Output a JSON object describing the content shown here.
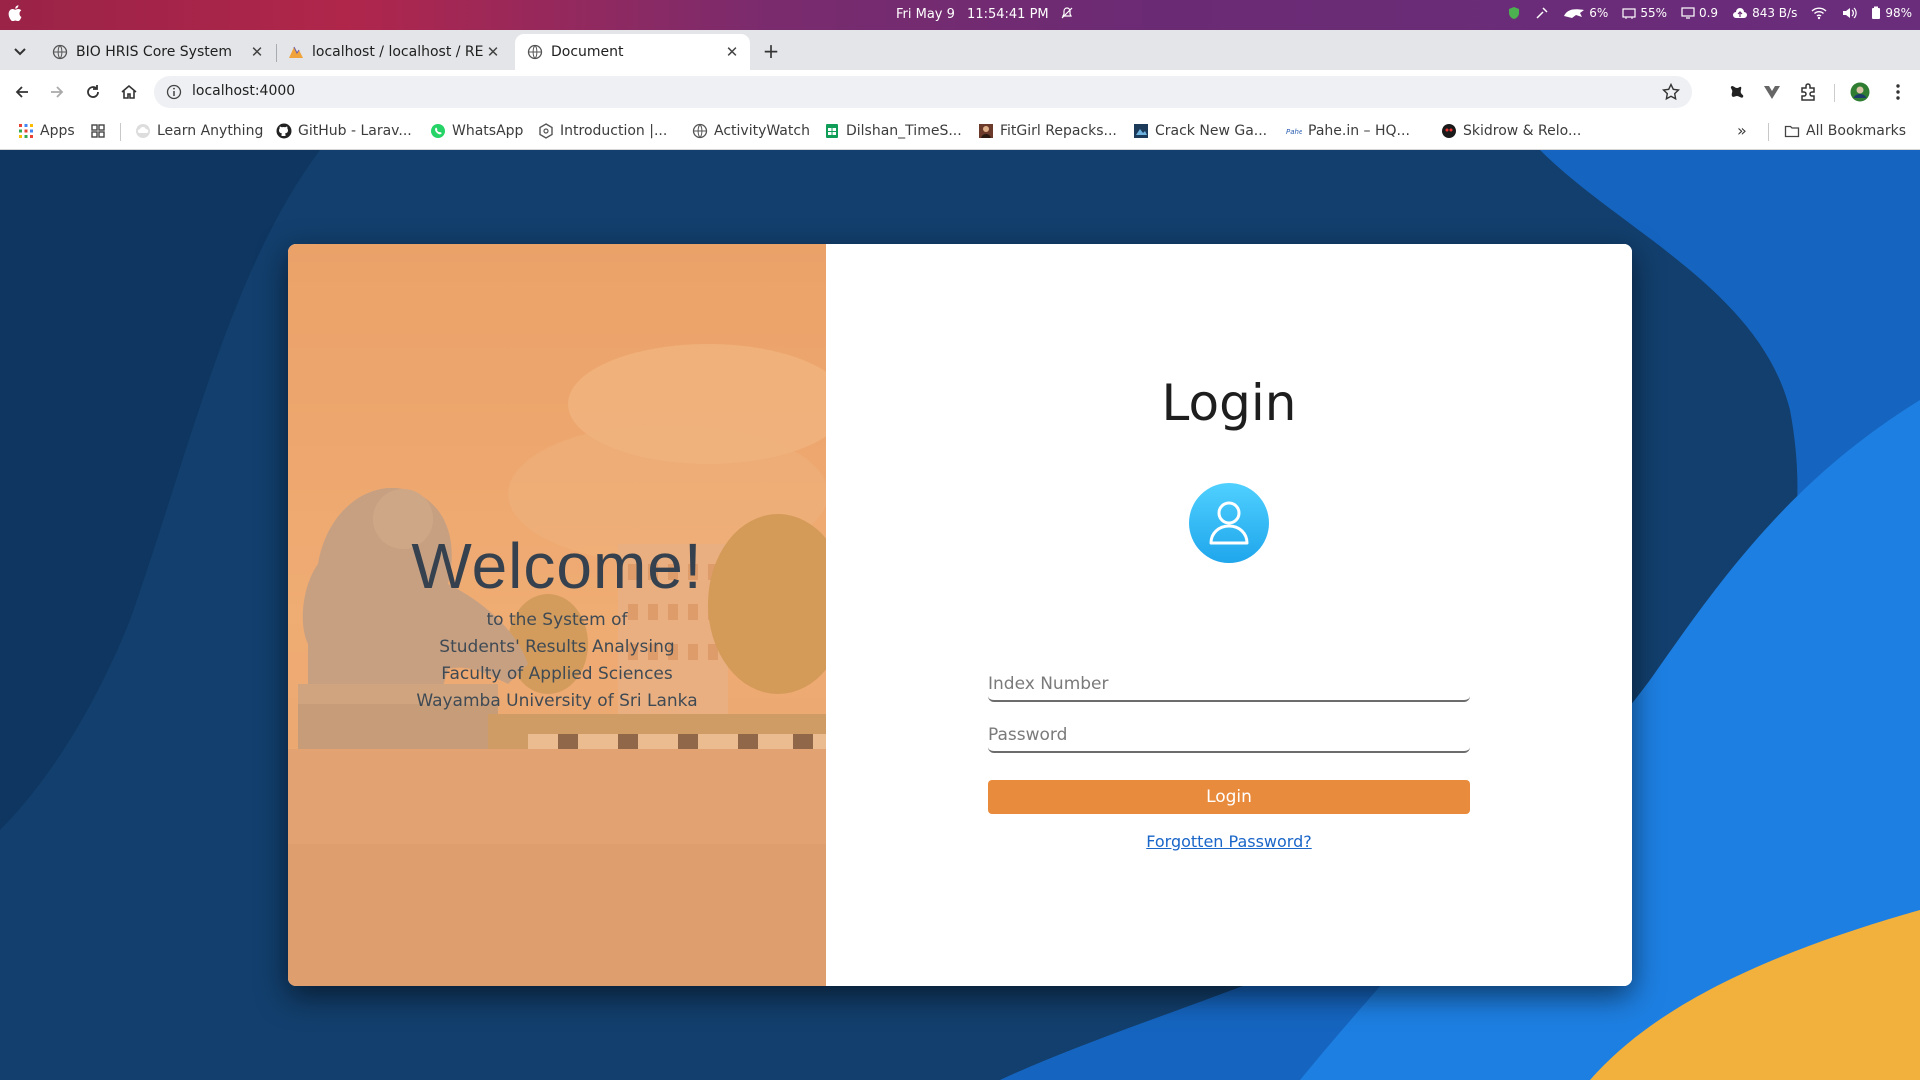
{
  "os_bar": {
    "date": "Fri May 9",
    "time": "11:54:41 PM",
    "tray": {
      "cpu": "6%",
      "memory": "55%",
      "load": "0.9",
      "network": "843 B/s",
      "battery": "98%"
    }
  },
  "browser": {
    "tabs": [
      {
        "title": "BIO HRIS Core System",
        "icon": "globe-icon",
        "active": false
      },
      {
        "title": "localhost / localhost / RE",
        "icon": "phpmyadmin-icon",
        "active": false
      },
      {
        "title": "Document",
        "icon": "globe-icon",
        "active": true
      }
    ],
    "address": {
      "url": "localhost:4000"
    },
    "bookmarks": [
      {
        "label": "Apps",
        "icon": "apps-grid-icon"
      },
      {
        "label": "",
        "icon": "grid-icon"
      },
      {
        "label": "Learn Anything",
        "icon": "cloud-icon"
      },
      {
        "label": "GitHub - Larav...",
        "icon": "github-icon"
      },
      {
        "label": "WhatsApp",
        "icon": "whatsapp-icon"
      },
      {
        "label": "Introduction |...",
        "icon": "hexagon-icon"
      },
      {
        "label": "ActivityWatch",
        "icon": "globe-icon"
      },
      {
        "label": "Dilshan_TimeS...",
        "icon": "sheets-icon"
      },
      {
        "label": "FitGirl Repacks...",
        "icon": "fitgirl-icon"
      },
      {
        "label": "Crack New Ga...",
        "icon": "game-icon"
      },
      {
        "label": "Pahe.in – HQ...",
        "icon": "pahe-icon"
      },
      {
        "label": "Skidrow & Relo...",
        "icon": "skidrow-icon"
      }
    ],
    "all_bookmarks": "All Bookmarks"
  },
  "welcome_panel": {
    "heading": "Welcome!",
    "lines": [
      "to the System of",
      "Students' Results Analysing",
      "Faculty of Applied Sciences",
      "Wayamba University of Sri Lanka"
    ]
  },
  "login_form": {
    "title": "Login",
    "avatar_icon": "user-icon",
    "index_placeholder": "Index Number",
    "password_placeholder": "Password",
    "submit_label": "Login",
    "forgot_label": "Forgotten Password?"
  },
  "colors": {
    "page_background": "#123f6d",
    "accent_blue": "#1f7fe0",
    "accent_yellow": "#f3b23a",
    "button_orange": "#e98b3c",
    "avatar_cyan": "#2bb6f5",
    "link_blue": "#1a66c9"
  }
}
